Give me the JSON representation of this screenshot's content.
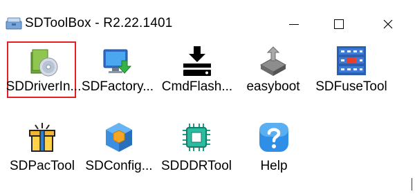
{
  "window": {
    "title": "SDToolBox - R2.22.1401",
    "app_icon": "sdtoolbox-icon",
    "controls": [
      "minimize",
      "maximize",
      "close"
    ]
  },
  "tools": [
    {
      "label": "SDDriverIn...",
      "icon": "driver-installer-icon",
      "selected": true
    },
    {
      "label": "SDFactory...",
      "icon": "monitor-download-icon",
      "selected": false
    },
    {
      "label": "CmdFlash...",
      "icon": "flash-drive-download-icon",
      "selected": false
    },
    {
      "label": "easyboot",
      "icon": "easyboot-icon",
      "selected": false
    },
    {
      "label": "SDFuseTool",
      "icon": "fuse-panel-icon",
      "selected": false
    },
    {
      "label": "SDPacTool",
      "icon": "package-gift-icon",
      "selected": false
    },
    {
      "label": "SDConfig...",
      "icon": "config-cube-icon",
      "selected": false
    },
    {
      "label": "SDDDRTool",
      "icon": "ddr-chip-icon",
      "selected": false
    },
    {
      "label": "Help",
      "icon": "help-icon",
      "selected": false
    }
  ],
  "colors": {
    "selection_border": "#e02020",
    "background": "#ffffff"
  }
}
